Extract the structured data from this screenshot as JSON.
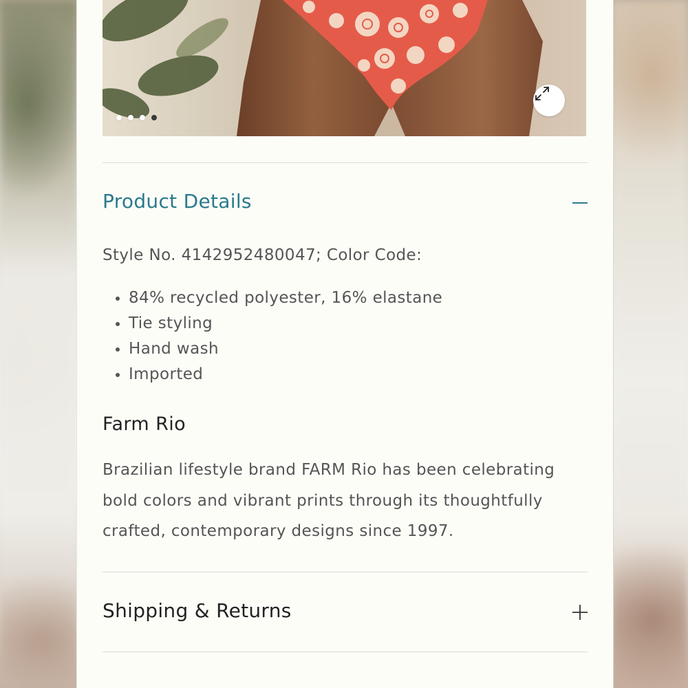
{
  "gallery": {
    "slide_count": 4,
    "active_slide": 4,
    "expand_icon": "expand-arrows-icon"
  },
  "product_details": {
    "title": "Product Details",
    "toggle_icon": "minus-icon",
    "expanded": true,
    "style_line": "Style No. 4142952480047; Color Code:",
    "specs": [
      "84% recycled polyester, 16% elastane",
      "Tie styling",
      "Hand wash",
      "Imported"
    ],
    "brand": {
      "heading": "Farm Rio",
      "description": "Brazilian lifestyle brand FARM Rio has been celebrating bold colors and vibrant prints through its thoughtfully crafted, contemporary designs since 1997."
    }
  },
  "shipping_returns": {
    "title": "Shipping & Returns",
    "toggle_icon": "plus-icon",
    "expanded": false
  },
  "colors": {
    "accent_teal": "#2a7a8c",
    "text_dark": "#222222",
    "text_body": "#555555",
    "panel_bg": "#fdfdf8"
  }
}
